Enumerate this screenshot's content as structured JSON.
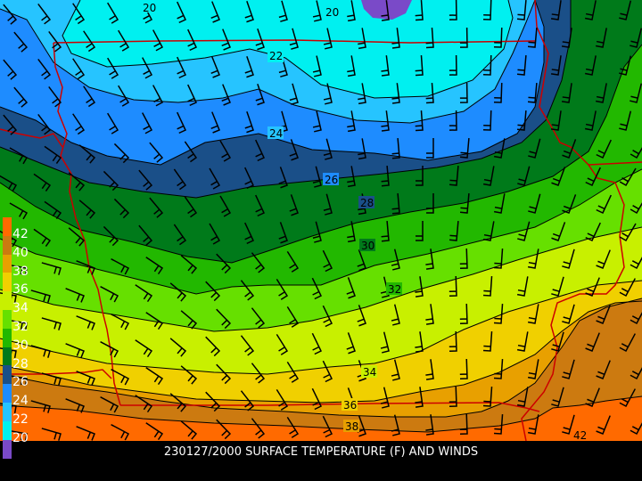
{
  "caption": "230127/2000 SURFACE TEMPERATURE (F) AND WINDS",
  "legend": [
    {
      "label": "42",
      "color": "#ff6a00"
    },
    {
      "label": "40",
      "color": "#cc7a10"
    },
    {
      "label": "38",
      "color": "#e8a000"
    },
    {
      "label": "36",
      "color": "#f0d000"
    },
    {
      "label": "34",
      "color": "#c8f000"
    },
    {
      "label": "32",
      "color": "#66e000"
    },
    {
      "label": "30",
      "color": "#22b800"
    },
    {
      "label": "28",
      "color": "#007a1a"
    },
    {
      "label": "26",
      "color": "#1a4f88"
    },
    {
      "label": "24",
      "color": "#1e8cff"
    },
    {
      "label": "22",
      "color": "#26c4ff"
    },
    {
      "label": "20",
      "color": "#00f0f0"
    },
    {
      "label": "",
      "color": "#7a4ac8"
    }
  ],
  "contour_labels": [
    "20",
    "20",
    "22",
    "24",
    "26",
    "28",
    "30",
    "32",
    "34",
    "36",
    "38",
    "42"
  ],
  "colors": {
    "background": "#000000",
    "boundary": "#cc0000",
    "wind_barb": "#000000",
    "caption_text": "#ffffff"
  }
}
